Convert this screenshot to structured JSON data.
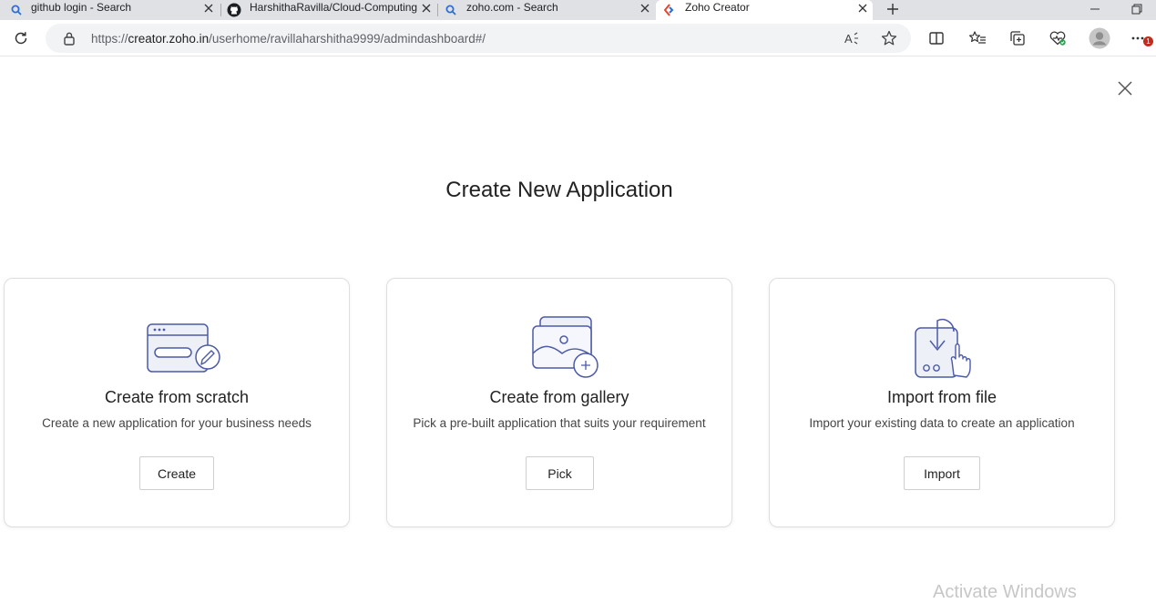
{
  "browser": {
    "tabs": [
      {
        "title": "github login - Search",
        "icon": "search-icon"
      },
      {
        "title": "HarshithaRavilla/Cloud-Computing",
        "icon": "github-icon"
      },
      {
        "title": "zoho.com - Search",
        "icon": "search-icon"
      },
      {
        "title": "Zoho Creator",
        "icon": "zoho-creator-icon"
      }
    ],
    "url_prefix": "https://",
    "url_host": "creator.zoho.in",
    "url_path": "/userhome/ravillaharshitha9999/admindashboard#/",
    "notification_badge": "1"
  },
  "dialog": {
    "title": "Create New Application",
    "cards": [
      {
        "title": "Create from scratch",
        "description": "Create a new application for your business needs",
        "button": "Create",
        "icon": "scratch-window-pencil-icon"
      },
      {
        "title": "Create from gallery",
        "description": "Pick a pre-built application that suits your requirement",
        "button": "Pick",
        "icon": "gallery-images-icon"
      },
      {
        "title": "Import from file",
        "description": "Import your existing data to create an application",
        "button": "Import",
        "icon": "import-device-hand-icon"
      }
    ]
  },
  "watermark": "Activate Windows"
}
